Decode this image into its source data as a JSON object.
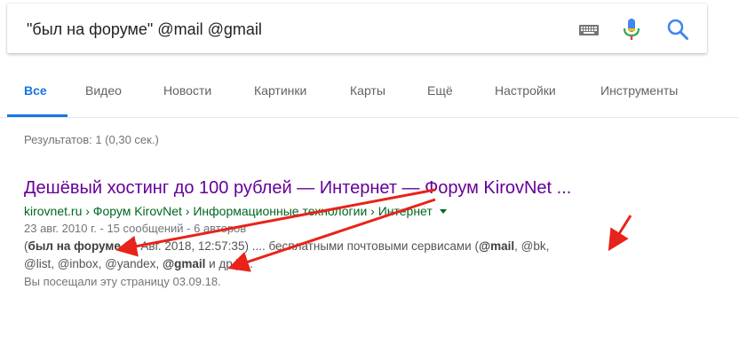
{
  "search": {
    "query": "\"был на форуме\" @mail @gmail"
  },
  "tabs": [
    {
      "label": "Все",
      "active": true
    },
    {
      "label": "Видео"
    },
    {
      "label": "Новости"
    },
    {
      "label": "Картинки"
    },
    {
      "label": "Карты"
    },
    {
      "label": "Ещё"
    },
    {
      "label": "Настройки"
    },
    {
      "label": "Инструменты"
    }
  ],
  "stats": "Результатов: 1 (0,30 сек.)",
  "result": {
    "title": "Дешёвый хостинг до 100 рублей — Интернет — Форум KirovNet ...",
    "breadcrumb": "kirovnet.ru › Форум KirovNet › Информационные технологии › Интернет",
    "meta": "23 авг. 2010 г. - 15 сообщений - 6 авторов",
    "snippet": {
      "open_paren": "(",
      "bold1": "был на форуме",
      "text1": " 08 Авг. 2018, 12:57:35) .... бесплатными почтовыми сервисами (",
      "bold2": "@mail",
      "text2": ", @bk,",
      "text3": "@list, @inbox, @yandex, ",
      "bold3": "@gmail",
      "text4": " и др.) ..."
    },
    "visited": "Вы посещали эту страницу 03.09.18."
  },
  "colors": {
    "accent": "#1a73e8",
    "visited_link": "#660099",
    "url_green": "#006621",
    "annotation_arrow": "#e8231a"
  },
  "icons": [
    "keyboard-icon",
    "mic-icon",
    "search-icon"
  ]
}
